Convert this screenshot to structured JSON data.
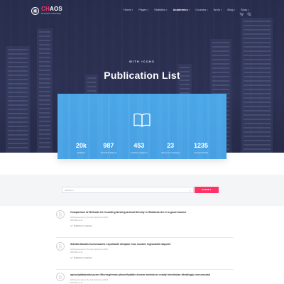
{
  "brand": {
    "name_accent": "CH",
    "name_rest": "AOS",
    "subtitle": "Research Laboratory"
  },
  "nav": {
    "items": [
      {
        "label": "Home",
        "dropdown": true,
        "active": false
      },
      {
        "label": "Pages",
        "dropdown": true,
        "active": false
      },
      {
        "label": "Statistics",
        "dropdown": true,
        "active": false
      },
      {
        "label": "Academics",
        "dropdown": true,
        "active": true
      },
      {
        "label": "Courses",
        "dropdown": true,
        "active": false
      },
      {
        "label": "Work",
        "dropdown": true,
        "active": false
      },
      {
        "label": "Blog",
        "dropdown": true,
        "active": false
      },
      {
        "label": "Shop",
        "dropdown": true,
        "active": false
      }
    ],
    "icons": [
      "cart-icon",
      "search-icon"
    ]
  },
  "hero": {
    "subtitle": "WITH ICONS",
    "title": "Publication List"
  },
  "stats": {
    "icon": "book-icon",
    "items": [
      {
        "value": "20k",
        "label": "Readers"
      },
      {
        "value": "987",
        "label": "Technical Papers"
      },
      {
        "value": "453",
        "label": "Another Category"
      },
      {
        "value": "23",
        "label": "Awesome Category"
      },
      {
        "value": "1235",
        "label": "Journal Articles"
      }
    ]
  },
  "search": {
    "placeholder": "SEARCH",
    "submit_label": "SUBMIT"
  },
  "publications": [
    {
      "title": "Comparison of Methods for Counting Nesting Animal Density in Wetlands Are in a good manner",
      "meta_1": "Achievements in the Life Sciences 2014",
      "meta_2": "MCFSE et al.",
      "link": "Publisher's website"
    },
    {
      "title": "Stanfordianalis homonuanhe expulsante atinptae esse sseubir regiscatibir daporte",
      "meta_1": "Achievements in the Life Sciences 2014",
      "meta_2": "MCFSE et al.",
      "link": "Publisher's website"
    },
    {
      "title": "apeoniplabiasntia poner Microsgirmme plmenthytable donem mmtrulces readly brenterdan trteatlogly cenrurossaxi",
      "meta_1": "Achievements in the Life Sciences 2014",
      "meta_2": "MCFSE et al.",
      "link": ""
    }
  ],
  "colors": {
    "hero_bg": "#2c3150",
    "accent": "#ff3366",
    "stats_bg": "#4aa7e8",
    "search_band": "#f4f5f7"
  }
}
